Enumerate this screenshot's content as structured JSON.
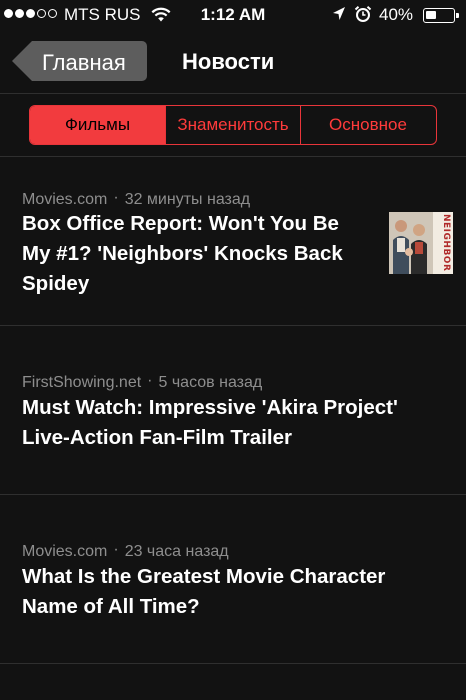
{
  "status_bar": {
    "carrier": "MTS RUS",
    "time": "1:12 AM",
    "battery_percent": "40%",
    "battery_level": 0.4,
    "signal_bars": 3,
    "icons": [
      "wifi-icon",
      "location-arrow-icon",
      "alarm-clock-icon",
      "battery-icon"
    ]
  },
  "nav": {
    "back_label": "Главная",
    "title": "Новости"
  },
  "segments": {
    "items": [
      "Фильмы",
      "Знаменитость",
      "Основное"
    ],
    "selected": "Фильмы"
  },
  "colors": {
    "accent": "#f23b3e",
    "background": "#121212",
    "meta_text": "#8e8e8e"
  },
  "articles": [
    {
      "source": "Movies.com",
      "time": "32 минуты назад",
      "title_lines": [
        "Box Office Report: Won't You Be",
        "My #1? 'Neighbors' Knocks Back",
        "Spidey"
      ],
      "thumbnail_text": "NEIGHBORS"
    },
    {
      "source": "FirstShowing.net",
      "time": "5 часов назад",
      "title_lines": [
        "Must Watch: Impressive 'Akira Project'",
        "Live-Action Fan-Film Trailer"
      ]
    },
    {
      "source": "Movies.com",
      "time": "23 часа назад",
      "title_lines": [
        "What Is the Greatest Movie Character",
        "Name of All Time?"
      ]
    }
  ]
}
